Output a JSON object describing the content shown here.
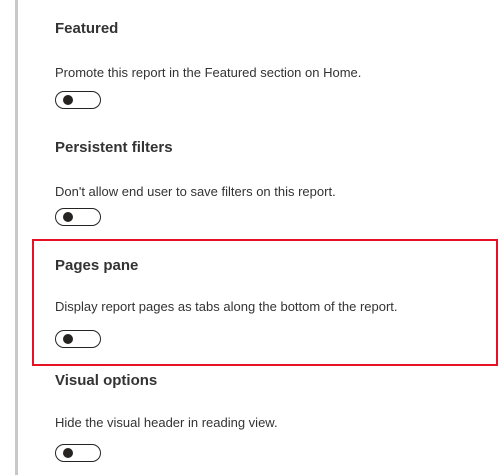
{
  "settings": [
    {
      "title": "Featured",
      "description": "Promote this report in the Featured section on Home.",
      "enabled": false
    },
    {
      "title": "Persistent filters",
      "description": "Don't allow end user to save filters on this report.",
      "enabled": false
    },
    {
      "title": "Pages pane",
      "description": "Display report pages as tabs along the bottom of the report.",
      "enabled": false
    },
    {
      "title": "Visual options",
      "description": "Hide the visual header in reading view.",
      "enabled": false
    }
  ],
  "highlight": {
    "target": "Pages pane",
    "color": "#e81123"
  },
  "colors": {
    "text": "#333333",
    "toggle": "#252423",
    "rail": "#c8c8c8"
  }
}
